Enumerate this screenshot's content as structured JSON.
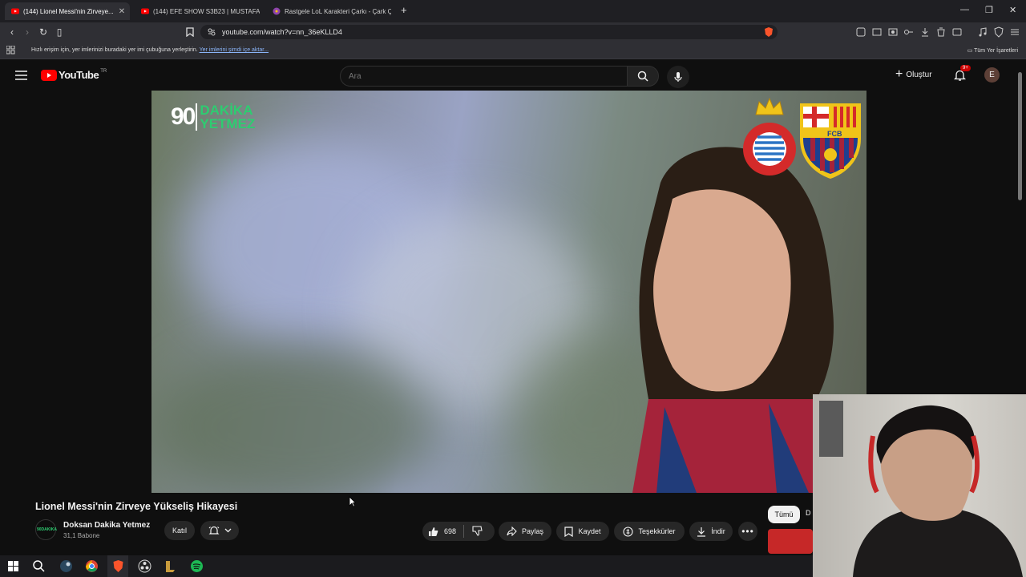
{
  "browser": {
    "tabs": [
      {
        "label": "(144) Lionel Messi'nin Zirveye...",
        "active": true
      },
      {
        "label": "(144) EFE SHOW S3B23 | MUSTAFA EI",
        "active": false
      },
      {
        "label": "Rastgele LoL Karakteri Çarkı - Çark Ç",
        "active": false
      }
    ],
    "url": "youtube.com/watch?v=nn_36eKLLD4",
    "bookmarks_hint": "Hızlı erişim için, yer imlerinizi buradaki yer imi çubuğuna yerleştirin.",
    "bookmarks_import_link": "Yer imlerini şimdi içe aktar...",
    "all_bookmarks": "Tüm Yer İşaretleri"
  },
  "youtube": {
    "logo_text": "YouTube",
    "region": "TR",
    "search_placeholder": "Ara",
    "create_label": "Oluştur",
    "notifications_badge": "9+",
    "avatar_letter": "E",
    "video": {
      "overlay_number": "90",
      "overlay_brand_line1": "DAKİKA",
      "overlay_brand_line2": "YETMEZ",
      "espanyol_badge_text": "RCD ESPANYOL DE BARCELONA",
      "fcb_badge_text": "FCB"
    },
    "title": "Lionel Messi'nin Zirveye Yükseliş Hikayesi",
    "channel": {
      "name": "Doksan Dakika Yetmez",
      "subscribers": "31,1 Babone",
      "avatar_text": "90DAKIKA"
    },
    "join_label": "Katıl",
    "likes": "698",
    "share_label": "Paylaş",
    "save_label": "Kaydet",
    "thanks_label": "Teşekkürler",
    "download_label": "İndir",
    "chip_all": "Tümü",
    "chip_next": "D"
  },
  "colors": {
    "yt_red": "#ff0000",
    "background": "#0f0f0f",
    "link_blue": "#8ab4f8",
    "brand_green": "#2ecc71"
  }
}
